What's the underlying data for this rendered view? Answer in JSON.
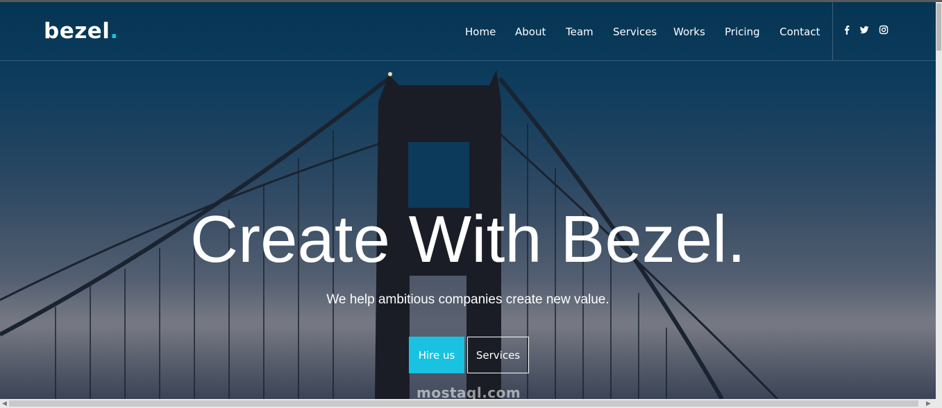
{
  "header": {
    "logo_text": "bezel",
    "logo_dot": ".",
    "accent_color": "#18c2e0"
  },
  "nav": {
    "items": [
      {
        "label": "Home"
      },
      {
        "label": "About"
      },
      {
        "label": "Team"
      },
      {
        "label": "Services"
      },
      {
        "label": "Works"
      },
      {
        "label": "Pricing"
      },
      {
        "label": "Contact"
      }
    ]
  },
  "social": {
    "icons": [
      "facebook-icon",
      "twitter-icon",
      "instagram-icon"
    ]
  },
  "hero": {
    "title": "Create With Bezel.",
    "subtitle": "We help ambitious companies create new value.",
    "primary_button": "Hire us",
    "secondary_button": "Services"
  },
  "watermark": {
    "text": "mostaql.com"
  }
}
